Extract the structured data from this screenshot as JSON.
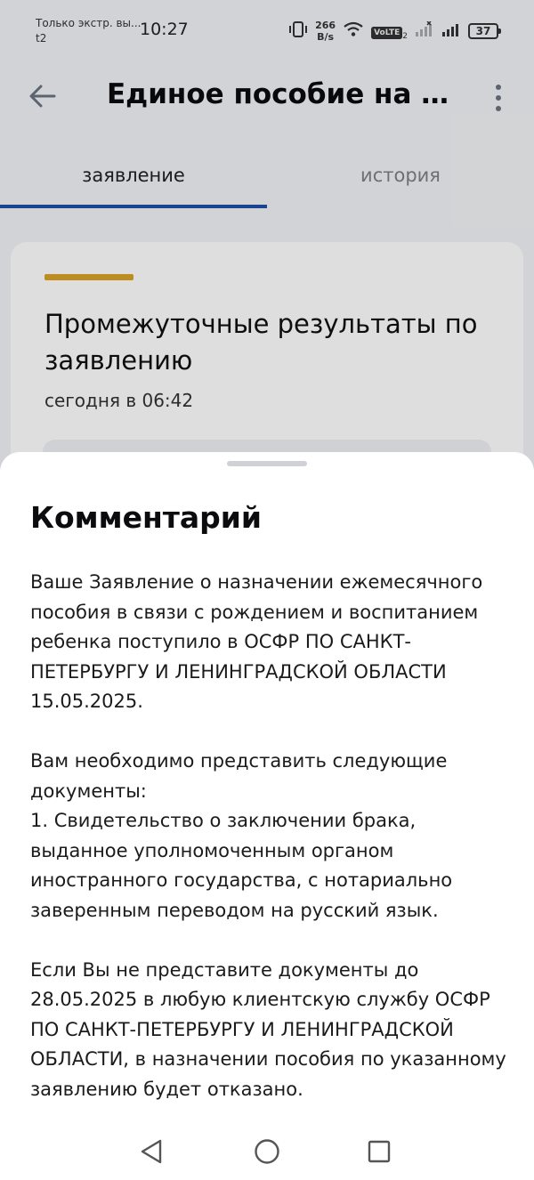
{
  "status_bar": {
    "carrier_line1": "Только экстр. вы...",
    "carrier_line2": "t2",
    "time": "10:27",
    "speed_value": "266",
    "speed_unit": "B/s",
    "volte": "VoLTE",
    "volte_sim": "2",
    "battery": "37"
  },
  "app_bar": {
    "title": "Единое пособие на де..."
  },
  "tabs": [
    {
      "label": "заявление",
      "active": true
    },
    {
      "label": "история",
      "active": false
    }
  ],
  "card": {
    "title": "Промежуточные результаты по заявлению",
    "time": "сегодня в 06:42",
    "accent_color": "#d9a22a"
  },
  "sheet": {
    "title": "Комментарий",
    "paragraphs": [
      "Ваше Заявление о назначении ежемесячного пособия в связи с рождением и воспитанием ребенка поступило в ОСФР ПО САНКТ-ПЕТЕРБУРГУ И ЛЕНИНГРАДСКОЙ ОБЛАСТИ 15.05.2025.",
      "Вам необходимо представить следующие документы:",
      "1. Свидетельство о заключении брака, выданное уполномоченным органом иностранного государства, с нотариально заверенным переводом на русский язык.",
      "Если Вы не представите документы до 28.05.2025 в любую клиентскую службу ОСФР ПО САНКТ-ПЕТЕРБУРГУ И ЛЕНИНГРАДСКОЙ ОБЛАСТИ, в назначении пособия по указанному заявлению будет отказано."
    ]
  },
  "colors": {
    "tab_indicator": "#1e4fa6",
    "icon_gray": "#6b7280"
  },
  "icons": {
    "back": "arrow-left-icon",
    "more": "more-vertical-icon",
    "nav_back": "triangle-back-icon",
    "nav_home": "circle-home-icon",
    "nav_recents": "square-recents-icon"
  }
}
